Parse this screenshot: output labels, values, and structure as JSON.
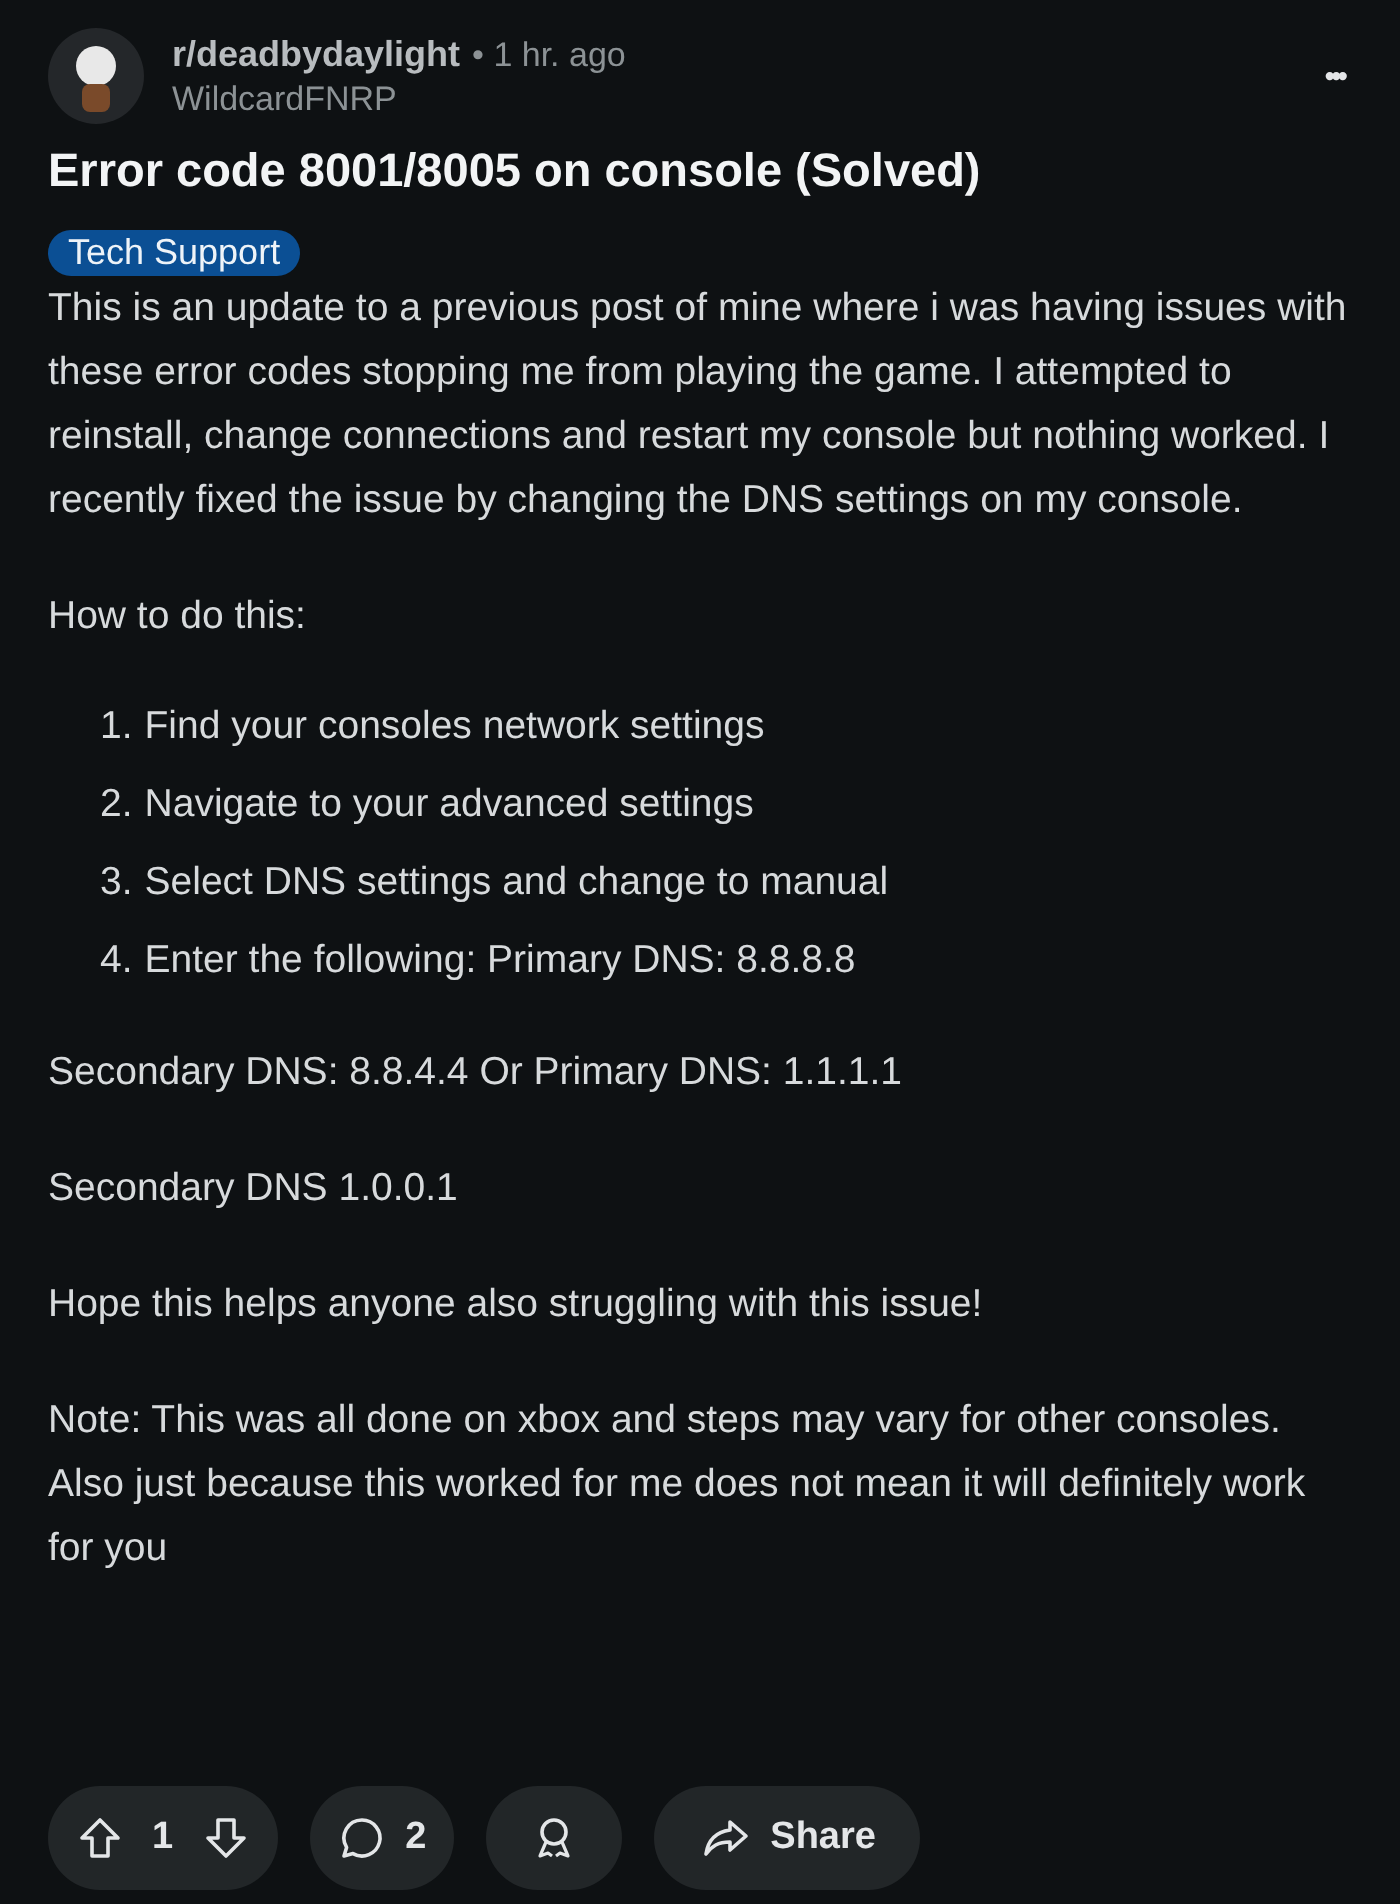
{
  "post": {
    "subreddit": "r/deadbydaylight",
    "separator": "•",
    "time": "1 hr. ago",
    "author": "WildcardFNRP",
    "menu": "•••",
    "title": "Error code 8001/8005 on console (Solved)",
    "flair": "Tech Support"
  },
  "body_intro": "This is an update to a previous post of mine where i was having issues with these error codes stopping me from playing the game. I attempted to reinstall, change connections and restart my console but nothing worked. I recently fixed the issue by changing the DNS settings on my console.",
  "how_to": "How to do this:",
  "steps": [
    {
      "number": "1.",
      "text": "Find your consoles network settings"
    },
    {
      "number": "2.",
      "text": "Navigate to your advanced settings"
    },
    {
      "number": "3.",
      "text": "Select DNS settings and change to manual"
    },
    {
      "number": "4.",
      "text": "Enter the following: Primary DNS: 8.8.8.8"
    }
  ],
  "paragraphs": [
    "Secondary DNS: 8.8.4.4 Or Primary DNS: 1.1.1.1",
    "Secondary DNS 1.0.0.1",
    "Hope this helps anyone also struggling with this issue!",
    "Note: This was all done on xbox and steps may vary for other consoles. Also just because this worked for me does not mean it will definitely work for you"
  ],
  "actions": {
    "votes": "1",
    "comments": "2",
    "share": "Share"
  }
}
